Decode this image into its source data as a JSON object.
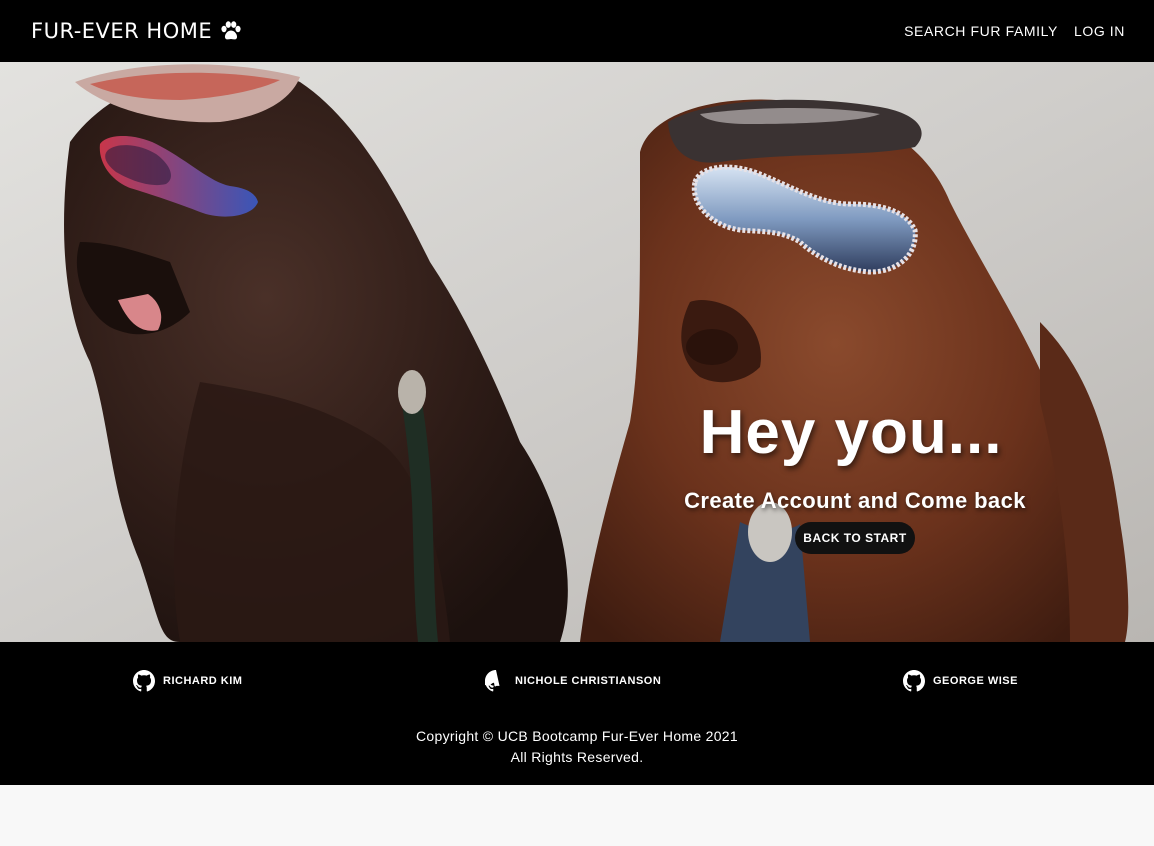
{
  "navbar": {
    "brand": "FUR-EVER HOME",
    "brand_icon": "paw-icon",
    "links": [
      {
        "label": "SEARCH FUR FAMILY"
      },
      {
        "label": "LOG IN"
      }
    ]
  },
  "hero": {
    "title": "Hey you...",
    "subtitle": "Create Account and Come back",
    "button_label": "BACK TO START",
    "image": "two-poodles-in-sunglasses-photo"
  },
  "footer": {
    "contributors": [
      {
        "name": "RICHARD KIM",
        "icon": "github-icon"
      },
      {
        "name": "NICHOLE CHRISTIANSON",
        "icon": "github-icon"
      },
      {
        "name": "GEORGE WISE",
        "icon": "github-icon"
      }
    ],
    "copyright_line1": "Copyright © UCB Bootcamp Fur-Ever Home 2021",
    "copyright_line2": "All Rights Reserved."
  },
  "colors": {
    "nav_bg": "#000000",
    "footer_bg": "#000000",
    "button_bg": "#111111",
    "page_bg": "#f8f8f8"
  }
}
